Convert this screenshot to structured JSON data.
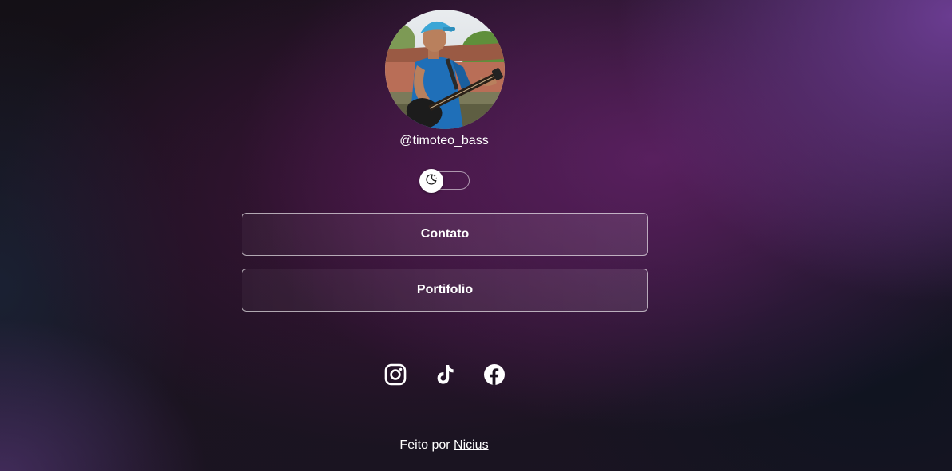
{
  "profile": {
    "avatar_icon": "profile-photo-bass-player",
    "handle": "@timoteo_bass"
  },
  "theme_toggle": {
    "icon": "moon-icon",
    "state": "dark"
  },
  "links": [
    {
      "label": "Contato"
    },
    {
      "label": "Portifolio"
    }
  ],
  "social": [
    {
      "icon": "instagram-icon"
    },
    {
      "icon": "tiktok-icon"
    },
    {
      "icon": "facebook-icon"
    }
  ],
  "footer": {
    "prefix": "Feito por",
    "author": "Nicius"
  },
  "colors": {
    "text": "#ffffff",
    "accent_purple": "#6e3e96",
    "background_dark": "#16111a"
  }
}
